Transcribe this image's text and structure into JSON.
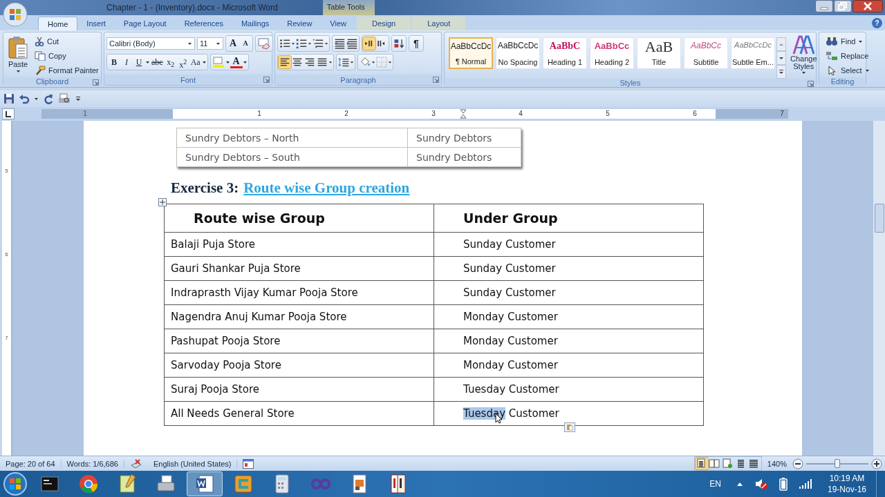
{
  "window": {
    "title": "Chapter - 1 - (Inventory).docx - Microsoft Word",
    "contextual_label": "Table Tools",
    "help": "?"
  },
  "tabs": [
    {
      "label": "Home",
      "selected": true,
      "contextual": false
    },
    {
      "label": "Insert",
      "selected": false,
      "contextual": false
    },
    {
      "label": "Page Layout",
      "selected": false,
      "contextual": false
    },
    {
      "label": "References",
      "selected": false,
      "contextual": false
    },
    {
      "label": "Mailings",
      "selected": false,
      "contextual": false
    },
    {
      "label": "Review",
      "selected": false,
      "contextual": false
    },
    {
      "label": "View",
      "selected": false,
      "contextual": false
    },
    {
      "label": "Design",
      "selected": false,
      "contextual": true
    },
    {
      "label": "Layout",
      "selected": false,
      "contextual": true
    }
  ],
  "clipboard": {
    "label": "Clipboard",
    "paste": "Paste",
    "cut": "Cut",
    "copy": "Copy",
    "format_painter": "Format Painter"
  },
  "font": {
    "label": "Font",
    "font_name": "Calibri (Body)",
    "font_size": "11",
    "size_buttons": [
      "A",
      "A"
    ],
    "format_buttons": [
      "B",
      "I",
      "U",
      "abc",
      "x$_{2}$",
      "x$^{2}$",
      "Aa"
    ],
    "font_color_button": "A"
  },
  "paragraph": {
    "label": "Paragraph",
    "show_marks": "¶",
    "direction_buttons": [
      {
        "kind": "ltr",
        "selected": true
      },
      {
        "kind": "rtl",
        "selected": false
      }
    ],
    "alignment_buttons": [
      {
        "kind": "left",
        "selected": true
      },
      {
        "kind": "center",
        "selected": false
      },
      {
        "kind": "right",
        "selected": false
      },
      {
        "kind": "justify",
        "selected": false
      }
    ]
  },
  "styles": {
    "label": "Styles",
    "change_styles": "Change Styles",
    "items": [
      {
        "preview": "AaBbCcDc",
        "name": "¶ Normal",
        "kind": "normal",
        "selected": true
      },
      {
        "preview": "AaBbCcDc",
        "name": "No Spacing",
        "kind": "normal",
        "selected": false
      },
      {
        "preview": "AaBbC",
        "name": "Heading 1",
        "kind": "heading1",
        "selected": false
      },
      {
        "preview": "AaBbCc",
        "name": "Heading 2",
        "kind": "heading2",
        "selected": false
      },
      {
        "preview": "AaB",
        "name": "Title",
        "kind": "title",
        "selected": false
      },
      {
        "preview": "AaBbCc",
        "name": "Subtitle",
        "kind": "subtitle",
        "selected": false
      },
      {
        "preview": "AaBbCcDc",
        "name": "Subtle Em...",
        "kind": "subtle",
        "selected": false
      }
    ]
  },
  "editing": {
    "label": "Editing",
    "find": "Find",
    "replace": "Replace",
    "select": "Select"
  },
  "ruler": {
    "labels": [
      "1",
      "1",
      "2",
      "3",
      "4",
      "5",
      "6",
      "7"
    ]
  },
  "vertical_ruler": {
    "labels": [
      "5",
      "6",
      "7"
    ]
  },
  "document": {
    "previous_table": {
      "rows": [
        [
          "Sundry Debtors – North",
          "Sundry Debtors"
        ],
        [
          "Sundry Debtors – South",
          "Sundry Debtors"
        ]
      ]
    },
    "exercise_heading": {
      "label": "Exercise 3:",
      "title": "Route wise Group creation"
    },
    "table": {
      "columns": [
        "Route wise Group",
        "Under Group"
      ],
      "rows": [
        {
          "cells": [
            "Balaji Puja Store",
            "Sunday Customer"
          ],
          "first_word_selected": false
        },
        {
          "cells": [
            "Gauri Shankar Puja Store",
            "Sunday Customer"
          ],
          "first_word_selected": false
        },
        {
          "cells": [
            "Indraprasth  Vijay Kumar Pooja Store",
            "Sunday Customer"
          ],
          "first_word_selected": false
        },
        {
          "cells": [
            "Nagendra Anuj Kumar Pooja Store",
            "Monday Customer"
          ],
          "first_word_selected": false
        },
        {
          "cells": [
            "Pashupat Pooja Store",
            "Monday Customer"
          ],
          "first_word_selected": false
        },
        {
          "cells": [
            "Sarvoday Pooja Store",
            "Monday Customer"
          ],
          "first_word_selected": false
        },
        {
          "cells": [
            "Suraj Pooja Store",
            "Tuesday Customer"
          ],
          "first_word_selected": false
        },
        {
          "cells": [
            "All Needs General Store",
            "Tuesday Customer"
          ],
          "first_word_selected": true
        }
      ]
    }
  },
  "status_bar": {
    "page": "Page: 20 of 64",
    "words": "Words: 1/6,686",
    "language": "English (United States)",
    "zoom": "140%",
    "zoom_level": {
      "level": 0.5
    },
    "views": [
      {
        "kind": "print",
        "selected": true
      },
      {
        "kind": "reading",
        "selected": false
      },
      {
        "kind": "web",
        "selected": false
      },
      {
        "kind": "outline",
        "selected": false
      },
      {
        "kind": "draft",
        "selected": false
      }
    ]
  },
  "taskbar": {
    "apps": [
      {
        "kind": "console",
        "selected": false
      },
      {
        "kind": "chrome",
        "selected": false
      },
      {
        "kind": "notepad",
        "selected": false
      },
      {
        "kind": "fax",
        "selected": false
      },
      {
        "kind": "word",
        "selected": true
      },
      {
        "kind": "game",
        "selected": false
      },
      {
        "kind": "calculator",
        "selected": false
      },
      {
        "kind": "infinity",
        "selected": false
      },
      {
        "kind": "document",
        "selected": false
      },
      {
        "kind": "book",
        "selected": false
      }
    ],
    "language": "EN",
    "time": "10:19 AM",
    "date": "19-Nov-16"
  }
}
